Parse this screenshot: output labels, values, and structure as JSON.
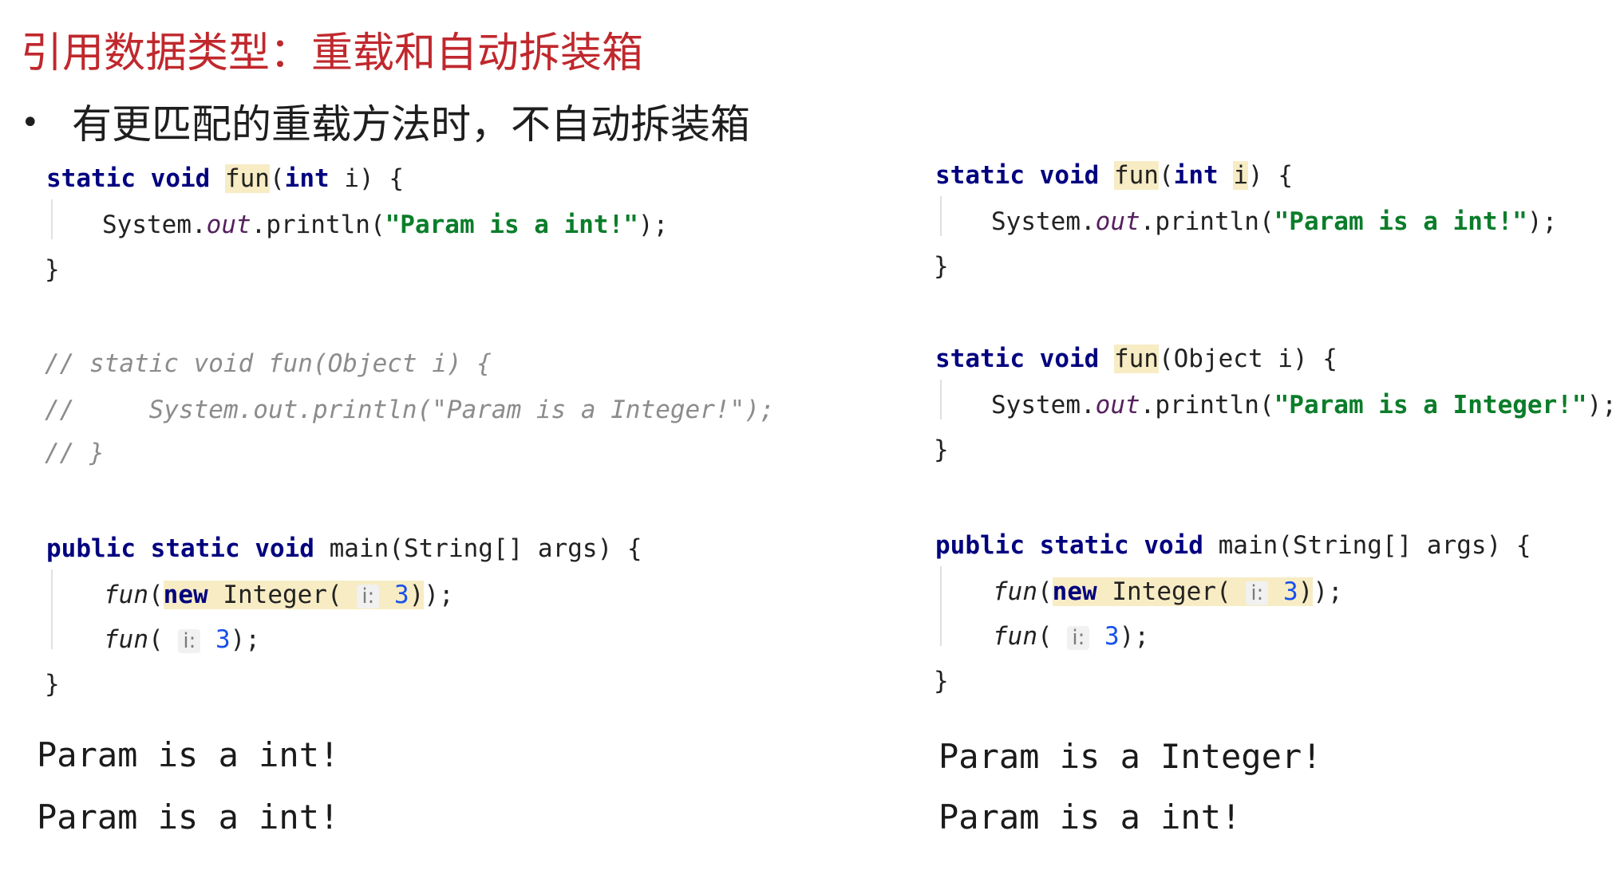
{
  "title": "引用数据类型：重载和自动拆装箱",
  "bullet": "有更匹配的重载方法时，不自动拆装箱",
  "bullet_marker": "•",
  "tokens": {
    "static": "static",
    "void": "void",
    "fun": "fun",
    "int": "int",
    "public": "public",
    "new": "new",
    "object_param": "(Object i)",
    "int_param_open": "(",
    "space_i_close": " i)",
    "i": "i",
    "close_paren": ")",
    "brace_open": " {",
    "brace_close": "}",
    "system": "System.",
    "out": "out",
    "println_open": ".println(",
    "str_int": "\"Param is a int!\"",
    "str_integer": "\"Param is a Integer!\"",
    "stmt_end": ");",
    "main_sig": "main(String[] args) {",
    "integer_open": " Integer(",
    "hint_label": "i:",
    "three": "3",
    "paren_open": "(",
    "paren_close_semi": ");",
    "close_two": "))",
    "semi": ";"
  },
  "left": {
    "comment_lines": [
      "// static void fun(Object i) {",
      "//     System.out.println(\"Param is a Integer!\");",
      "// }"
    ],
    "outputs": [
      "Param is a int!",
      "Param is a int!"
    ]
  },
  "right": {
    "outputs": [
      "Param is a Integer!",
      "Param is a int!"
    ]
  }
}
